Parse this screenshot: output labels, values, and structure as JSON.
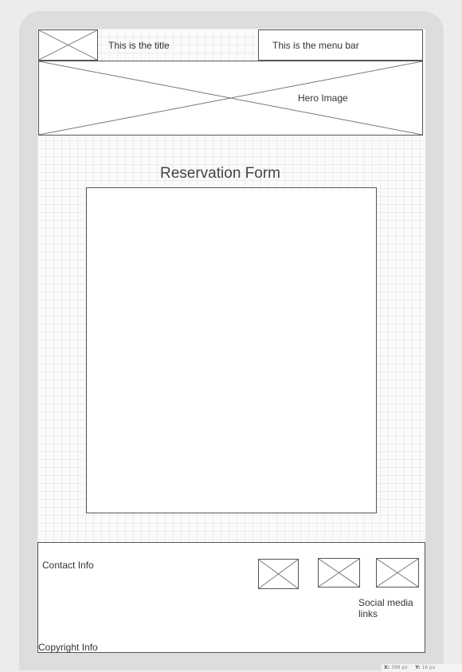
{
  "header": {
    "logo_icon": "image-placeholder-icon",
    "title": "This is the title",
    "menu_bar": "This is the menu bar"
  },
  "hero": {
    "label": "Hero Image",
    "icon": "image-placeholder-icon"
  },
  "main": {
    "form_title": "Reservation Form"
  },
  "footer": {
    "contact": "Contact Info",
    "social": "Social media links",
    "copyright": "Copyright Info",
    "social_icons": [
      "image-placeholder-icon",
      "image-placeholder-icon",
      "image-placeholder-icon"
    ]
  },
  "status": {
    "x_label": "X:",
    "x_value": "398 px",
    "y_label": "Y:",
    "y_value": "16 px"
  },
  "colors": {
    "device_frame": "#dddddd",
    "canvas": "#fbfbfb",
    "grid": "#ececec",
    "stroke": "#555555"
  }
}
